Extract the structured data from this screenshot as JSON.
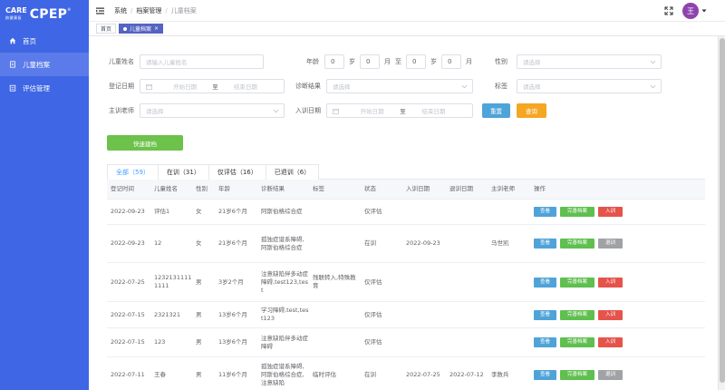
{
  "brand": {
    "care": "CARE",
    "care_sub": "韵健康复",
    "cpep": "CPEP",
    "reg": "®"
  },
  "sidebar": {
    "items": [
      {
        "label": "首页",
        "icon": "home-icon",
        "active": false
      },
      {
        "label": "儿童档案",
        "icon": "document-icon",
        "active": true
      },
      {
        "label": "评估管理",
        "icon": "clipboard-icon",
        "active": false
      }
    ]
  },
  "header": {
    "breadcrumbs": [
      "系统",
      "档案管理",
      "儿童档案"
    ],
    "avatar_text": "王"
  },
  "tags": [
    {
      "label": "首页",
      "active": false
    },
    {
      "label": "儿童档案",
      "active": true
    }
  ],
  "filters": {
    "child_name_label": "儿童姓名",
    "child_name_placeholder": "请输入儿童姓名",
    "age_label": "年龄",
    "age_from_years": "0",
    "age_from_months": "0",
    "age_to_years": "0",
    "age_to_months": "0",
    "unit_year": "岁",
    "unit_month": "月",
    "unit_to": "至",
    "gender_label": "性别",
    "gender_placeholder": "请选择",
    "reg_date_label": "登记日期",
    "start_date": "开始日期",
    "end_date": "结束日期",
    "range_sep": "至",
    "diagnosis_label": "诊断结果",
    "diagnosis_placeholder": "请选择",
    "tag_label": "标签",
    "tag_placeholder": "请选择",
    "teacher_label": "主训老师",
    "teacher_placeholder": "请选择",
    "train_date_label": "入训日期",
    "reset_label": "重置",
    "query_label": "查询"
  },
  "quick_button": "快速建档",
  "tabs": [
    {
      "label": "全部（59）",
      "active": true
    },
    {
      "label": "在训（31）",
      "active": false
    },
    {
      "label": "仅评估（16）",
      "active": false
    },
    {
      "label": "已退训（6）",
      "active": false
    }
  ],
  "table": {
    "columns": [
      "登记时间",
      "儿童姓名",
      "性别",
      "年龄",
      "诊断结果",
      "标签",
      "状态",
      "入训日期",
      "退训日期",
      "主训老师",
      "操作"
    ],
    "actions": {
      "view": "查看",
      "done": "完善档案",
      "in": "入训",
      "out": "退训"
    },
    "rows": [
      {
        "date": "2022-09-23",
        "name": "评估1",
        "gender": "女",
        "age": "21岁6个月",
        "diag": "阿斯伯格综合症",
        "tag": "",
        "status": "仅评估",
        "in_date": "",
        "out_date": "",
        "teacher": "",
        "third": "in"
      },
      {
        "date": "2022-09-23",
        "name": "12",
        "gender": "女",
        "age": "21岁6个月",
        "diag": "孤独症谱系障碍,阿斯伯格综合症",
        "tag": "",
        "status": "在训",
        "in_date": "2022-09-23",
        "out_date": "",
        "teacher": "马世凯",
        "third": "out"
      },
      {
        "date": "2022-07-25",
        "name": "12321311111111",
        "gender": "男",
        "age": "3岁2个月",
        "diag": "注意缺陷伴多动症障碍,test123,test",
        "tag": "残联转入,特殊教育",
        "status": "仅评估",
        "in_date": "",
        "out_date": "",
        "teacher": "",
        "third": "in"
      },
      {
        "date": "2022-07-15",
        "name": "2321321",
        "gender": "男",
        "age": "13岁6个月",
        "diag": "学习障碍,test,test123",
        "tag": "",
        "status": "仅评估",
        "in_date": "",
        "out_date": "",
        "teacher": "",
        "third": "in"
      },
      {
        "date": "2022-07-15",
        "name": "123",
        "gender": "男",
        "age": "13岁6个月",
        "diag": "注意缺陷伴多动症障碍",
        "tag": "",
        "status": "仅评估",
        "in_date": "",
        "out_date": "",
        "teacher": "",
        "third": "in"
      },
      {
        "date": "2022-07-11",
        "name": "王春",
        "gender": "男",
        "age": "11岁6个月",
        "diag": "孤独症谱系障碍,阿斯伯格综合症,注意缺陷",
        "tag": "临时评估",
        "status": "在训",
        "in_date": "2022-07-25",
        "out_date": "2022-07-12",
        "teacher": "李数兵",
        "third": "out"
      }
    ]
  },
  "colors": {
    "sidebar": "#3f66e4",
    "reset": "#4fa3d8",
    "query": "#f5a623",
    "quick": "#6cc24a"
  }
}
